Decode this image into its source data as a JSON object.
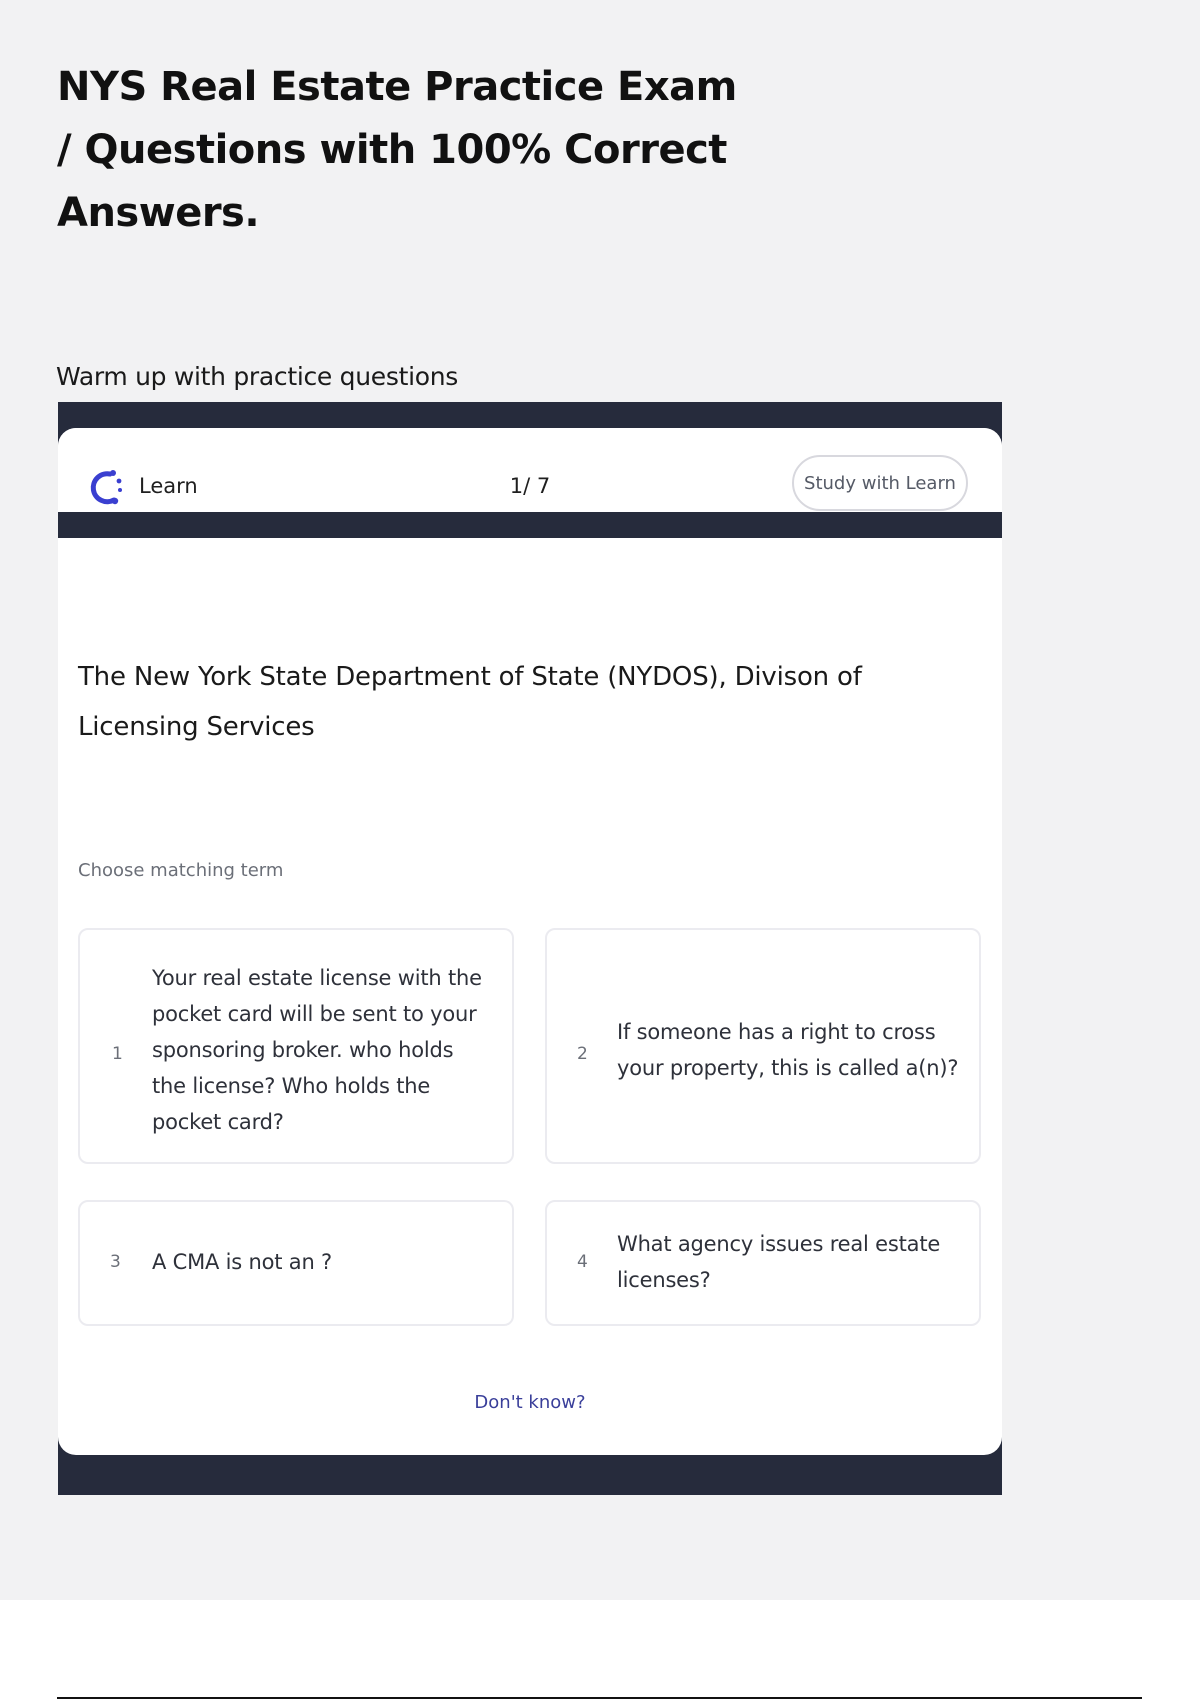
{
  "document": {
    "title": "NYS Real Estate Practice Exam / Questions with 100% Correct Answers.",
    "section_label": "Warm up with practice questions"
  },
  "widget": {
    "logo_label": "Learn",
    "logo_icon": "learn-logo-icon",
    "progress": "1/ 7",
    "study_button_label": "Study with Learn",
    "question": "The New York State Department of State (NYDOS), Divison of Licensing Services",
    "instruction": "Choose matching term",
    "options": [
      {
        "number": "1",
        "text": "Your real estate license with the pocket card will be sent to your sponsoring broker. who holds the license? Who holds the pocket card?"
      },
      {
        "number": "2",
        "text": "If someone has a right to cross your property, this is called a(n)?"
      },
      {
        "number": "3",
        "text": "A CMA is not an ?"
      },
      {
        "number": "4",
        "text": "What agency issues real estate licenses?"
      }
    ],
    "dont_know_label": "Don't know?",
    "colors": {
      "frame": "#262b3c",
      "accent": "#3a3fd0",
      "link": "#3a3f9a",
      "page_background": "#f2f2f3"
    }
  }
}
